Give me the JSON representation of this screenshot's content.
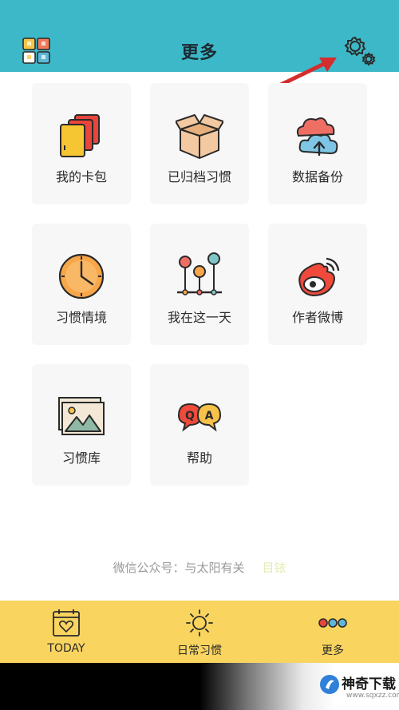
{
  "header": {
    "title": "更多",
    "left_icon": "app-grid-icon",
    "right_icon": "settings-gear-icon",
    "annotation": "red-arrow-icon"
  },
  "tiles": [
    {
      "label": "我的卡包",
      "icon": "card-wallet-icon"
    },
    {
      "label": "已归档习惯",
      "icon": "archive-box-icon"
    },
    {
      "label": "数据备份",
      "icon": "cloud-backup-icon"
    },
    {
      "label": "习惯情境",
      "icon": "clock-icon"
    },
    {
      "label": "我在这一天",
      "icon": "timeline-pins-icon"
    },
    {
      "label": "作者微博",
      "icon": "weibo-icon"
    },
    {
      "label": "习惯库",
      "icon": "picture-gallery-icon"
    },
    {
      "label": "帮助",
      "icon": "qa-bubbles-icon"
    }
  ],
  "footer": {
    "wechat_text": "微信公众号：与太阳有关",
    "faded_text": "目铱"
  },
  "tabbar": {
    "tabs": [
      {
        "label": "TODAY",
        "icon": "calendar-heart-icon"
      },
      {
        "label": "日常习惯",
        "icon": "sun-icon"
      },
      {
        "label": "更多",
        "icon": "more-dots-icon"
      }
    ]
  },
  "watermark": {
    "name": "神奇下载",
    "url": "www.sqxzz.com"
  },
  "colors": {
    "header": "#3cb8c8",
    "tabbar": "#f9d45e",
    "tile_bg": "#f7f7f7",
    "arrow": "#d42d2d"
  }
}
